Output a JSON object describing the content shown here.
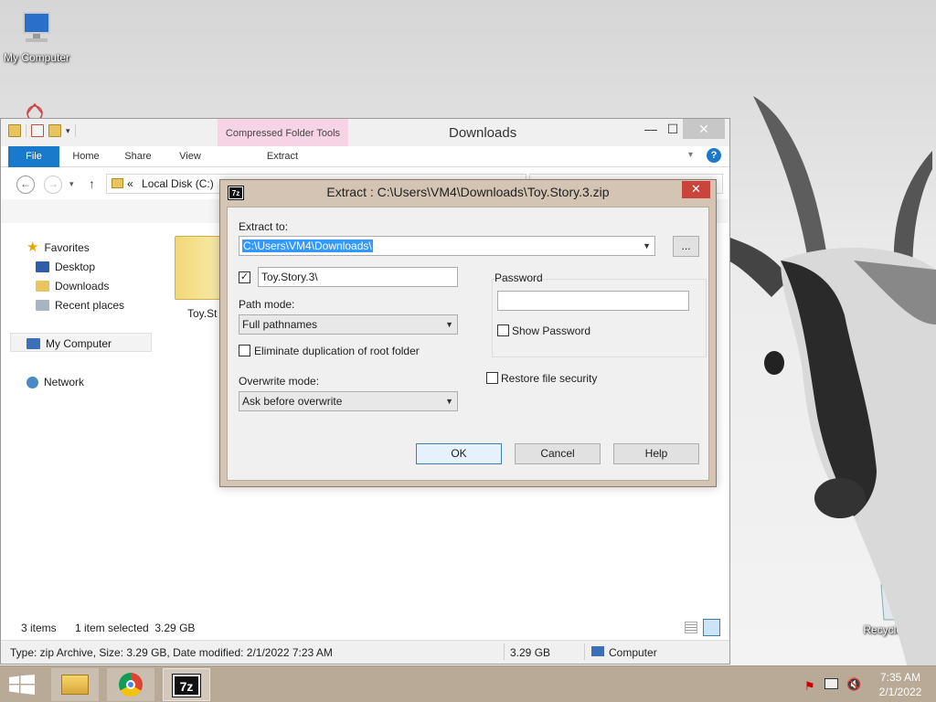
{
  "desktop": {
    "icons": [
      {
        "label": "My Computer",
        "icon": "computer-icon"
      },
      {
        "label": "Recycle Bin",
        "icon": "recycle-bin-icon"
      }
    ]
  },
  "explorer": {
    "title": "Downloads",
    "context_tab_group": "Compressed Folder Tools",
    "tabs": [
      "File",
      "Home",
      "Share",
      "View",
      "Extract"
    ],
    "address": {
      "prefix": "«",
      "path": "Local Disk (C:)"
    },
    "nav": {
      "favorites": "Favorites",
      "favorites_items": [
        "Desktop",
        "Downloads",
        "Recent places"
      ],
      "computer": "My Computer",
      "network": "Network"
    },
    "file_item_label": "Toy.St",
    "status": {
      "items": "3 items",
      "selected": "1 item selected  3.29 GB"
    },
    "details": {
      "type_info": "Type: zip Archive, Size: 3.29 GB, Date modified: 2/1/2022 7:23 AM",
      "size": "3.29 GB",
      "location": "Computer"
    },
    "window_controls": {
      "minimize": "—",
      "maximize": "☐",
      "close": "✕"
    }
  },
  "dialog": {
    "title": "Extract : C:\\Users\\VM4\\Downloads\\Toy.Story.3.zip",
    "logo": "7z",
    "extract_to_label": "Extract to:",
    "extract_to_value": "C:\\Users\\VM4\\Downloads\\",
    "browse_label": "...",
    "subfolder_checked": true,
    "subfolder_value": "Toy.Story.3\\",
    "path_mode_label": "Path mode:",
    "path_mode_value": "Full pathnames",
    "eliminate_dup_label": "Eliminate duplication of root folder",
    "overwrite_mode_label": "Overwrite mode:",
    "overwrite_mode_value": "Ask before overwrite",
    "password_label": "Password",
    "password_value": "",
    "show_password_label": "Show Password",
    "restore_security_label": "Restore file security",
    "buttons": {
      "ok": "OK",
      "cancel": "Cancel",
      "help": "Help"
    }
  },
  "taskbar": {
    "apps": [
      "file-explorer-icon",
      "chrome-icon",
      "7zip-icon"
    ],
    "seven_zip_label": "7z",
    "time": "7:35 AM",
    "date": "2/1/2022"
  }
}
